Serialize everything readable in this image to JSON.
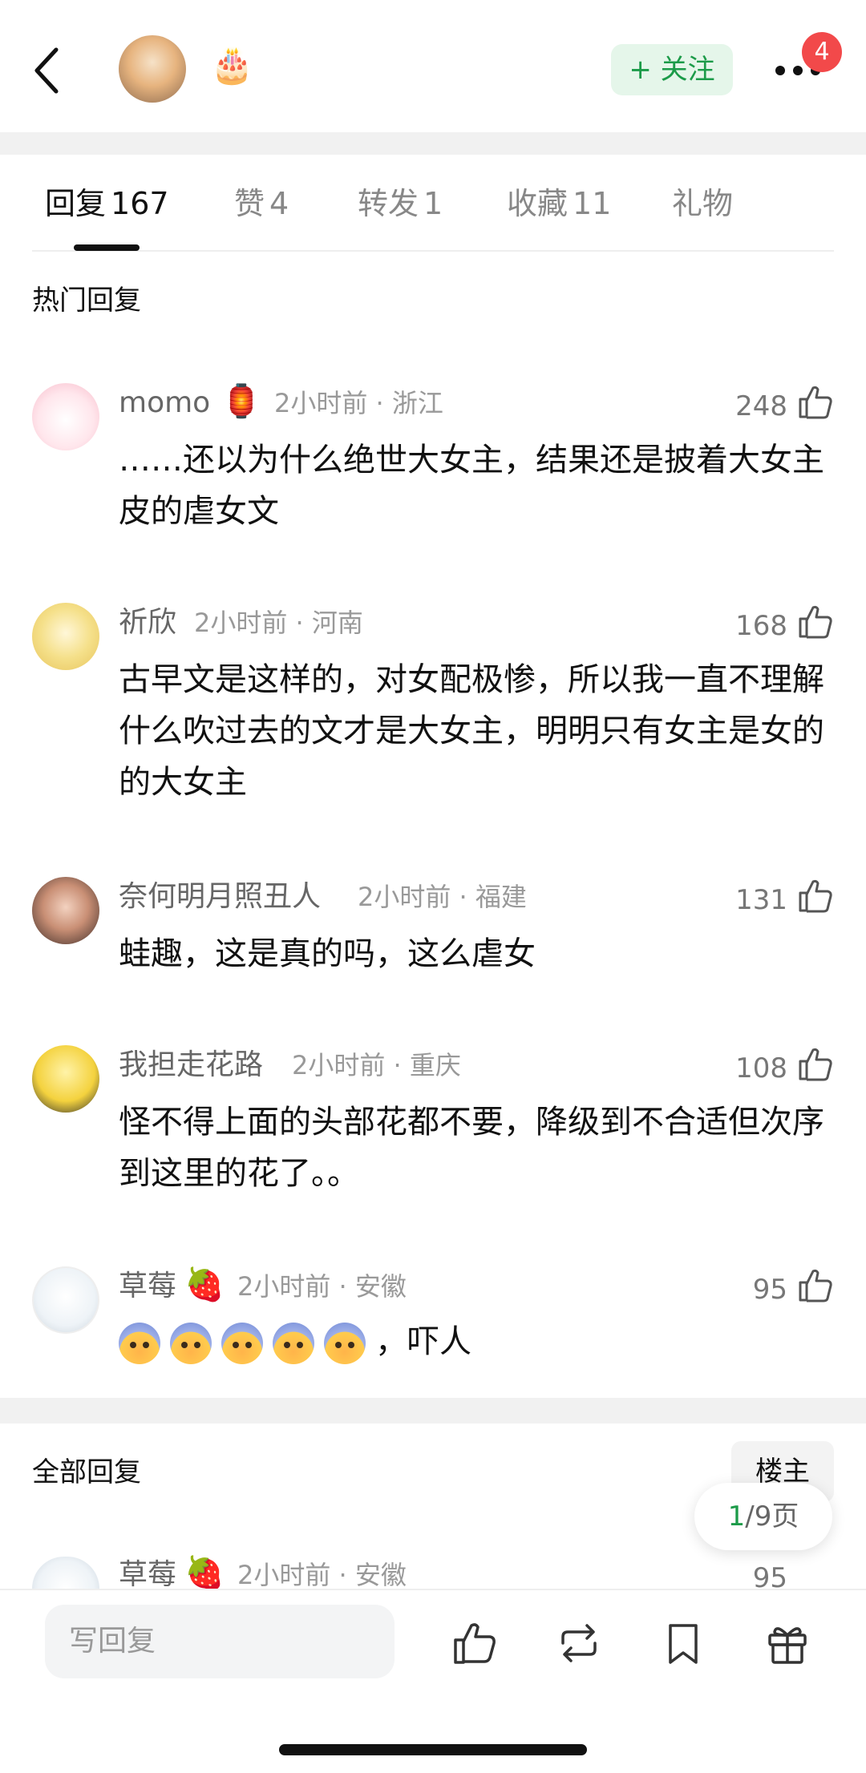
{
  "header": {
    "follow_label": "+ 关注",
    "notification_count": "4",
    "cake_icon": "🎂"
  },
  "tabs": [
    {
      "label": "回复",
      "count": "167"
    },
    {
      "label": "赞",
      "count": "4"
    },
    {
      "label": "转发",
      "count": "1"
    },
    {
      "label": "收藏",
      "count": "11"
    },
    {
      "label": "礼物",
      "count": ""
    }
  ],
  "hot_section_title": "热门回复",
  "hot_comments": [
    {
      "name": "momo",
      "badge_icon": "🏮",
      "meta": "2小时前 · 浙江",
      "likes": "248",
      "text": "……还以为什么绝世大女主，结果还是披着大女主皮的虐女文"
    },
    {
      "name": "祈欣",
      "meta": "2小时前 · 河南",
      "likes": "168",
      "text": "古早文是这样的，对女配极惨，所以我一直不理解什么吹过去的文才是大女主，明明只有女主是女的的大女主"
    },
    {
      "name": "奈何明月照丑人",
      "meta": "2小时前 · 福建",
      "likes": "131",
      "text": "蛙趣，这是真的吗，这么虐女"
    },
    {
      "name": "我担走花路",
      "meta": "2小时前 · 重庆",
      "likes": "108",
      "text": "怪不得上面的头部花都不要，降级到不合适但次序到这里的花了。。"
    },
    {
      "name": "草莓",
      "badge_icon": "🍓",
      "meta": "2小时前 · 安徽",
      "likes": "95",
      "text": "，吓人"
    }
  ],
  "all_section_title": "全部回复",
  "louzhu_label": "楼主",
  "pager": {
    "current": "1",
    "total": "/9页"
  },
  "partial_comment": {
    "name": "草莓",
    "badge_icon": "🍓",
    "meta": "2小时前 · 安徽",
    "likes": "95"
  },
  "bottom": {
    "reply_placeholder": "写回复"
  },
  "colors": {
    "accent_green": "#1c9b49",
    "follow_bg": "#e5f6ea",
    "badge_red": "#f2494a"
  }
}
